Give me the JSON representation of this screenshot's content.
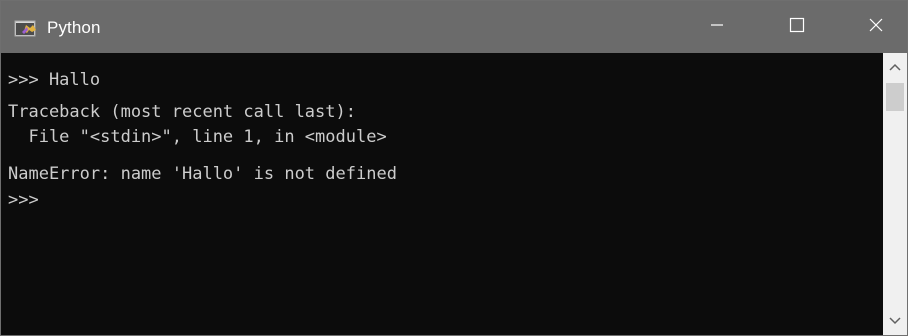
{
  "window": {
    "title": "Python",
    "icons": {
      "app": "python-console-icon",
      "minimize": "minimize-icon",
      "maximize": "maximize-icon",
      "close": "close-icon",
      "scroll_up": "chevron-up-icon",
      "scroll_down": "chevron-down-icon"
    }
  },
  "console": {
    "lines": [
      ">>> Hallo",
      "Traceback (most recent call last):",
      "  File \"<stdin>\", line 1, in <module>",
      "NameError: name 'Hallo' is not defined",
      ">>>"
    ],
    "colors": {
      "background": "#0c0c0c",
      "text": "#cccccc"
    }
  },
  "colors": {
    "titlebar": "#6b6b6b",
    "scrollbar_track": "#f0f0f0",
    "scrollbar_thumb": "#cdcdcd"
  }
}
